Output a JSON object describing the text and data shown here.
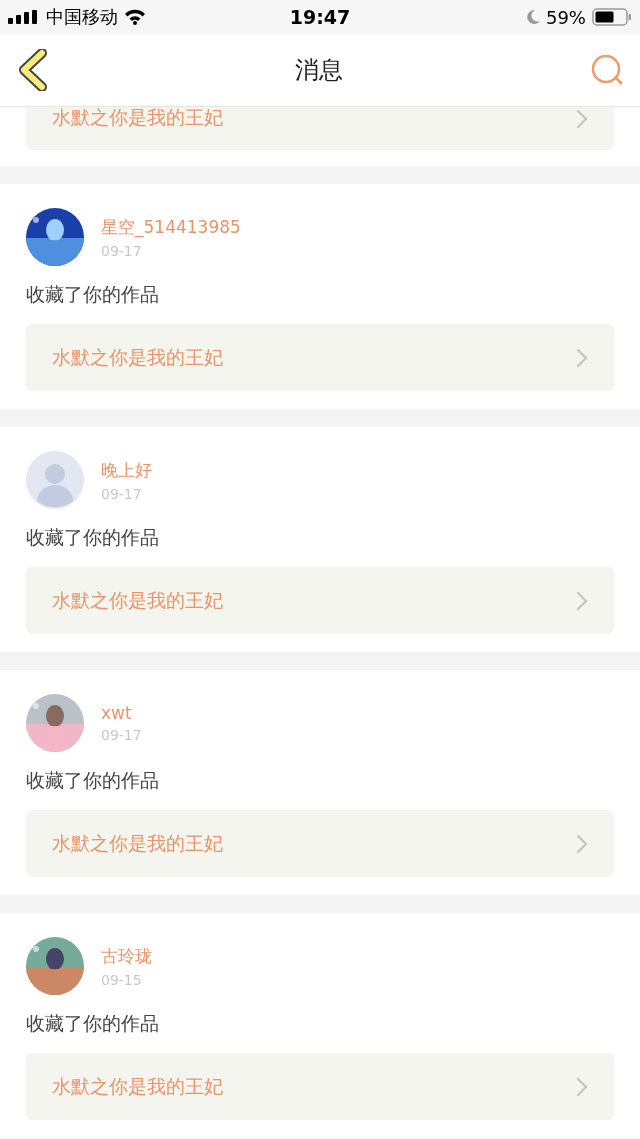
{
  "status_bar": {
    "carrier": "中国移动",
    "time": "19:47",
    "battery": "59%"
  },
  "nav_bar": {
    "title": "消息"
  },
  "partial_item": {
    "work": "水默之你是我的王妃"
  },
  "messages": [
    {
      "user": "星空_514413985",
      "date": "09-17",
      "action": "收藏了你的作品",
      "work": "水默之你是我的王妃"
    },
    {
      "user": "晚上好",
      "date": "09-17",
      "avatar": {
        "kind": "default"
      },
      "action": "收藏了你的作品",
      "work": "水默之你是我的王妃"
    },
    {
      "user": "xwt",
      "date": "09-17",
      "action": "收藏了你的作品",
      "work": "水默之你是我的王妃"
    },
    {
      "user": "古玲珑",
      "date": "09-15",
      "action": "收藏了你的作品",
      "work": "水默之你是我的王妃"
    }
  ]
}
